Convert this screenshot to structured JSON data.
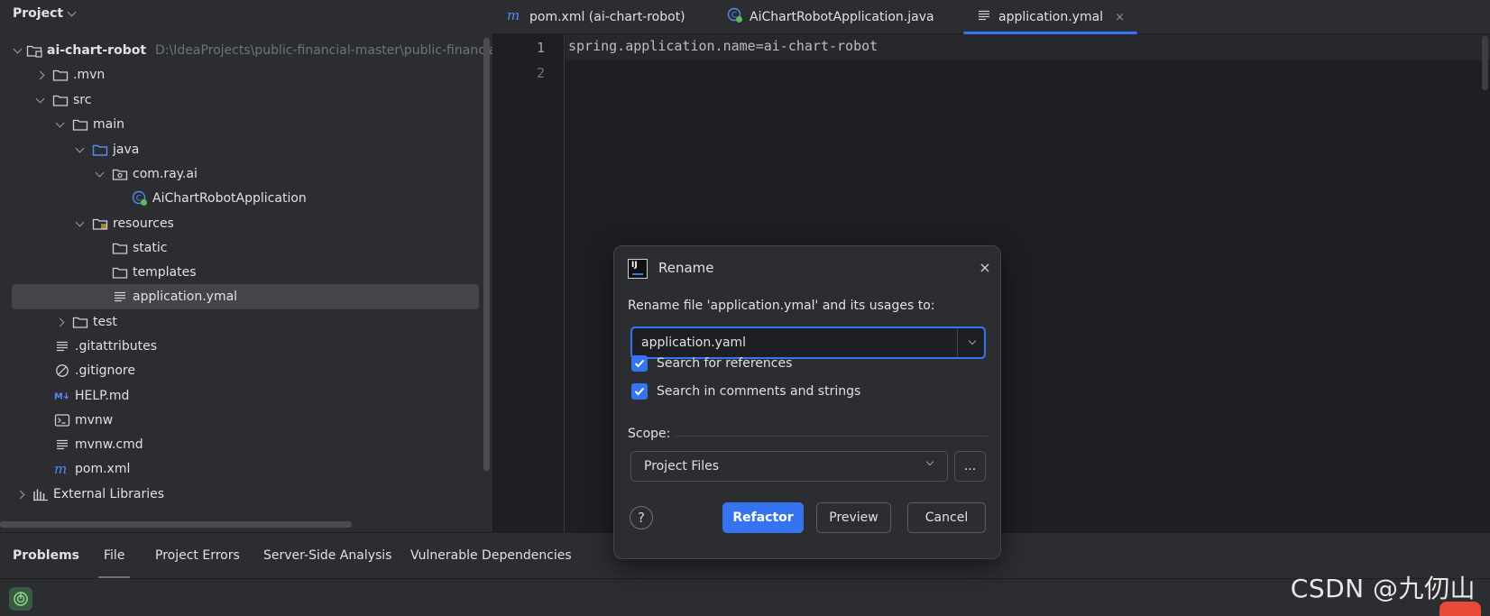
{
  "project_panel": {
    "title": "Project",
    "tree": [
      {
        "label": "ai-chart-robot",
        "path": "D:\\IdeaProjects\\public-financial-master\\public-financial",
        "icon": "module-folder-icon",
        "expanded": true,
        "bold": true
      },
      {
        "label": ".mvn",
        "icon": "folder-icon",
        "expanded": false
      },
      {
        "label": "src",
        "icon": "folder-icon",
        "expanded": true
      },
      {
        "label": "main",
        "icon": "folder-icon",
        "expanded": true
      },
      {
        "label": "java",
        "icon": "source-folder-icon",
        "expanded": true
      },
      {
        "label": "com.ray.ai",
        "icon": "package-icon",
        "expanded": true
      },
      {
        "label": "AiChartRobotApplication",
        "icon": "spring-boot-class-icon"
      },
      {
        "label": "resources",
        "icon": "resources-folder-icon",
        "expanded": true
      },
      {
        "label": "static",
        "icon": "folder-icon"
      },
      {
        "label": "templates",
        "icon": "folder-icon"
      },
      {
        "label": "application.ymal",
        "icon": "text-file-icon",
        "selected": true
      },
      {
        "label": "test",
        "icon": "folder-icon",
        "expanded": false
      },
      {
        "label": ".gitattributes",
        "icon": "text-file-icon"
      },
      {
        "label": ".gitignore",
        "icon": "ignore-file-icon"
      },
      {
        "label": "HELP.md",
        "icon": "markdown-icon"
      },
      {
        "label": "mvnw",
        "icon": "terminal-file-icon"
      },
      {
        "label": "mvnw.cmd",
        "icon": "text-file-icon"
      },
      {
        "label": "pom.xml",
        "icon": "maven-icon"
      },
      {
        "label": "External Libraries",
        "icon": "libraries-icon",
        "expanded": false
      }
    ]
  },
  "editor": {
    "tabs": [
      {
        "label": "pom.xml (ai-chart-robot)",
        "icon": "maven-icon"
      },
      {
        "label": "AiChartRobotApplication.java",
        "icon": "spring-boot-class-icon"
      },
      {
        "label": "application.ymal",
        "icon": "text-file-icon",
        "active": true,
        "close": "×"
      }
    ],
    "line_numbers": [
      "1",
      "2"
    ],
    "code_lines": [
      "spring.application.name=ai-chart-robot"
    ]
  },
  "problems": {
    "tabs": [
      "Problems",
      "File",
      "Project Errors",
      "Server-Side Analysis",
      "Vulnerable Dependencies"
    ],
    "watermark": "CSDN @九仞山"
  },
  "dialog": {
    "logo_text": "IJ",
    "title": "Rename",
    "close": "×",
    "prompt": "Rename file 'application.ymal' and its usages to:",
    "new_name": "application.yaml",
    "checkboxes": [
      {
        "label": "Search for references",
        "checked": true
      },
      {
        "label": "Search in comments and strings",
        "checked": true
      }
    ],
    "scope_label": "Scope:",
    "scope_value": "Project Files",
    "scope_more": "...",
    "help": "?",
    "buttons": {
      "refactor": "Refactor",
      "preview": "Preview",
      "cancel": "Cancel"
    }
  },
  "colors": {
    "accent": "#3574f0",
    "panel_bg": "#2b2d30",
    "editor_bg": "#1e1f22"
  }
}
